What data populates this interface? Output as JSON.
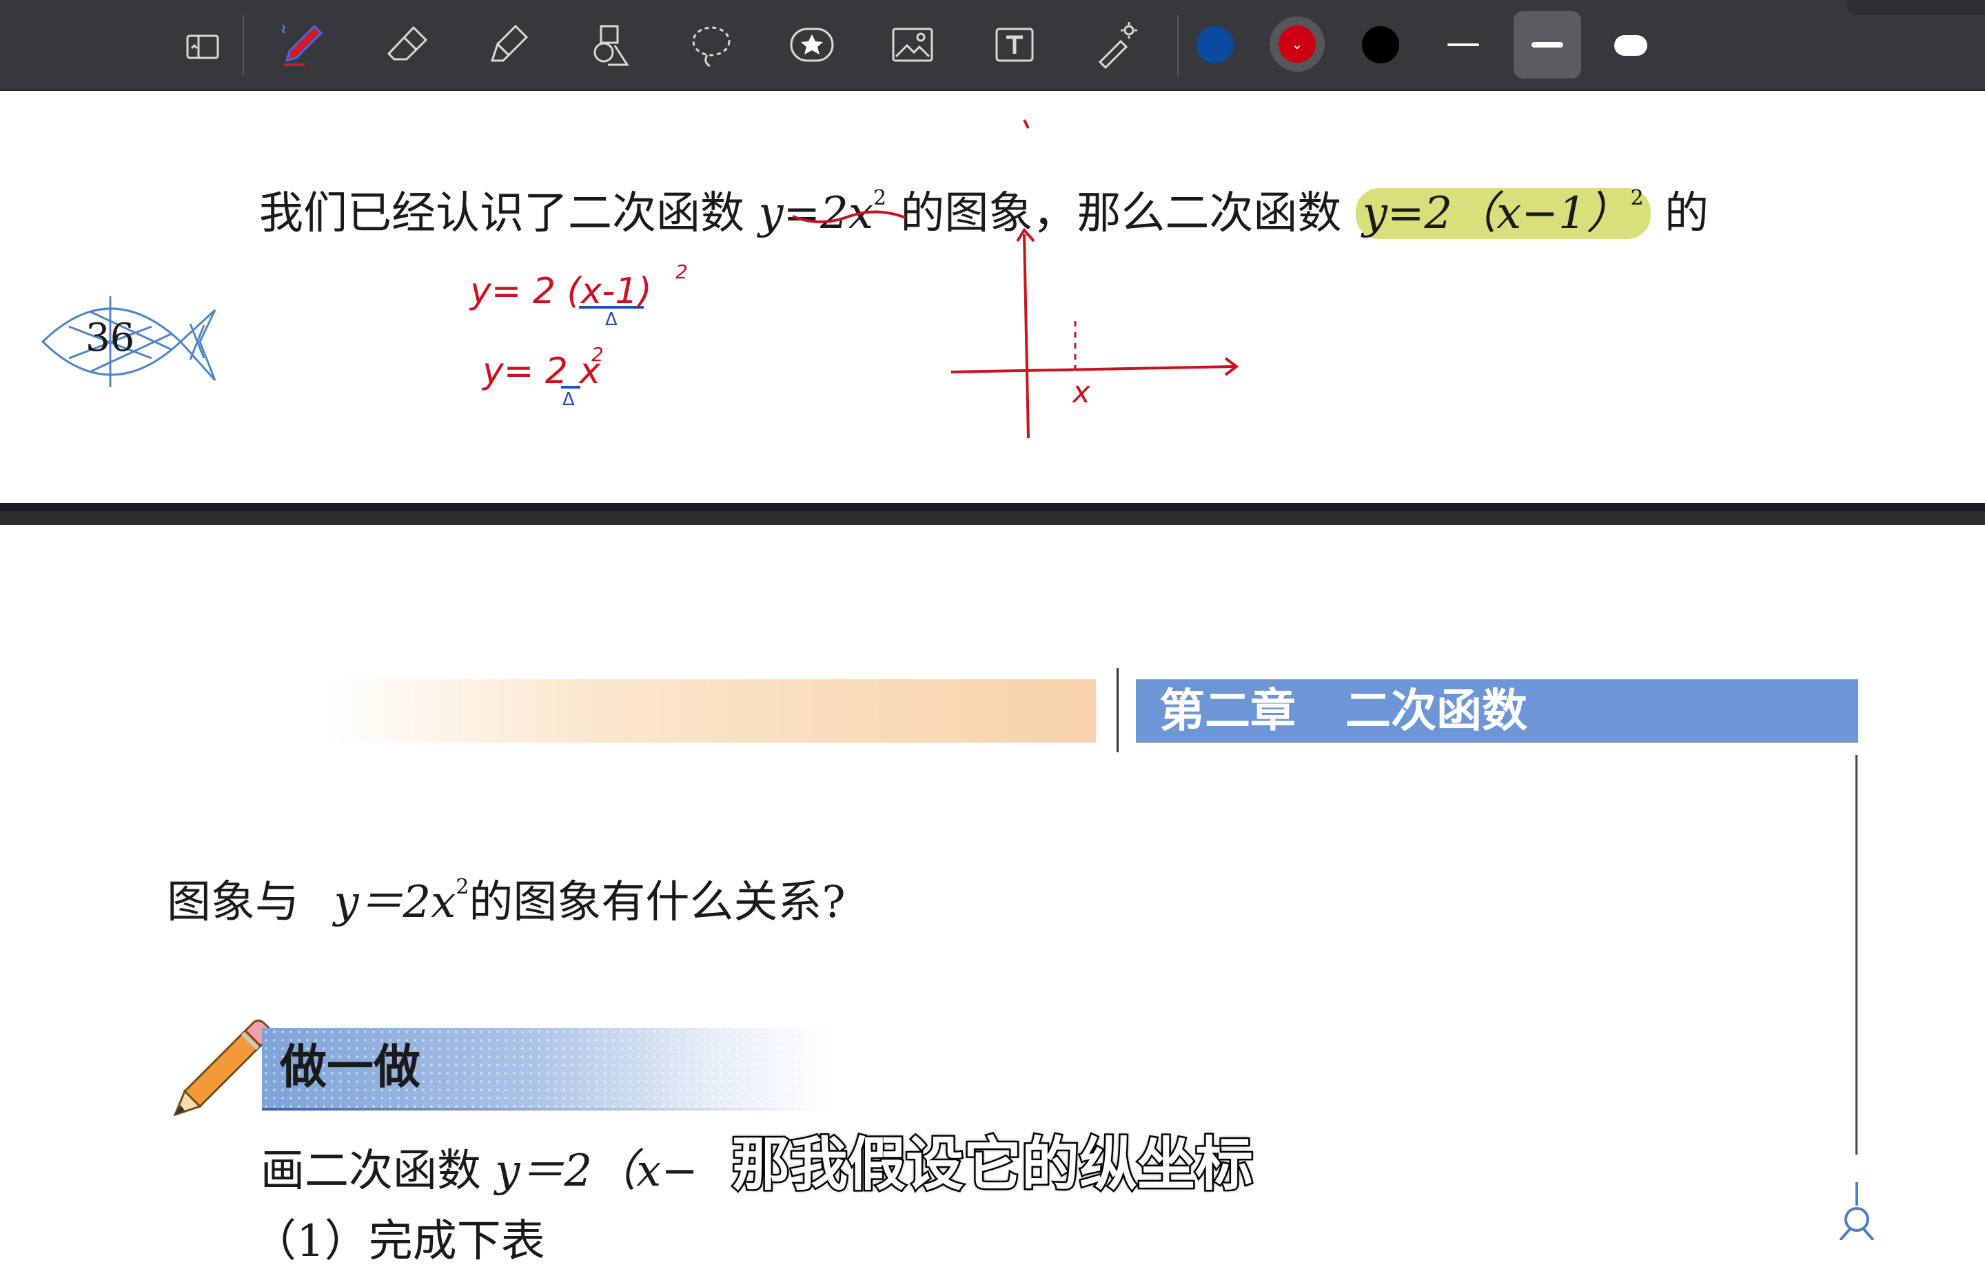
{
  "toolbar": {
    "tools": [
      {
        "name": "pages-icon"
      },
      {
        "name": "pen-icon"
      },
      {
        "name": "eraser-icon"
      },
      {
        "name": "highlighter-icon"
      },
      {
        "name": "shapes-icon"
      },
      {
        "name": "lasso-icon"
      },
      {
        "name": "sticker-icon"
      },
      {
        "name": "image-icon"
      },
      {
        "name": "text-icon"
      },
      {
        "name": "laser-pointer-icon"
      }
    ],
    "colors": [
      "#0a4aa0",
      "#cc0011",
      "#000000"
    ],
    "selected_color": "#cc0011",
    "selected_stroke": 2
  },
  "top_page": {
    "line_prefix": "我们已经认识了二次函数",
    "eq1": "y=2x",
    "eq1_exp": "2",
    "mid_text": "的图象，那么二次函数",
    "eq2": "y=2（x−1）",
    "eq2_exp": "2",
    "suffix": "的",
    "page_number": "36"
  },
  "handwriting": {
    "eq_a": "y= 2 (x-1)",
    "eq_a_exp": "2",
    "eq_b": "y= 2 x",
    "eq_b_exp": "2",
    "delta": "Δ",
    "axis_label": "x"
  },
  "lower_page": {
    "chapter_num": "第二章",
    "chapter_title": "二次函数",
    "question_prefix": "图象与",
    "question_eq": "y＝2x",
    "question_exp": "2",
    "question_suffix": "的图象有什么关系?",
    "section_label": "做一做",
    "exercise_prefix": "画二次函数",
    "exercise_eq": "y＝2（x−",
    "exercise_line2": "（1）完成下表"
  },
  "subtitle": "那我假设它的纵坐标"
}
